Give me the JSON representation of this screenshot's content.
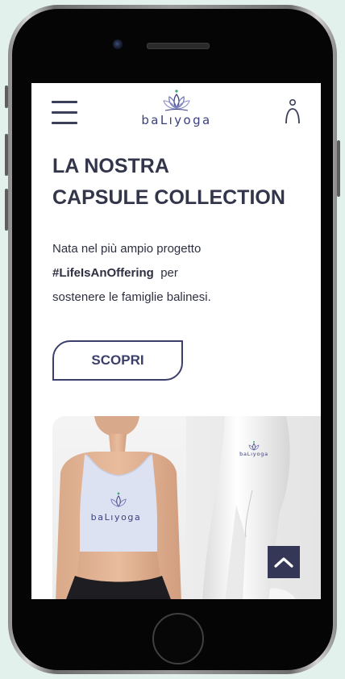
{
  "header": {
    "brand": "baLıyoga",
    "menu_icon": "hamburger-menu-icon",
    "account_icon": "user-icon",
    "brand_color": "#3a3f7d"
  },
  "hero": {
    "headline_line1": "LA NOSTRA",
    "headline_line2": "CAPSULE COLLECTION",
    "desc_line1": "Nata nel più ampio progetto",
    "desc_hashtag": "#LifeIsAnOffering",
    "desc_after_hashtag": "per",
    "desc_line3": "sostenere le famiglie balinesi.",
    "cta_label": "SCOPRI"
  },
  "gallery": {
    "top_logo": "baLıyoga",
    "leggings_logo": "baLıyoga"
  },
  "scroll_top": {
    "icon": "chevron-up-icon"
  },
  "colors": {
    "background": "#e3f1ec",
    "text_dark": "#33364a",
    "accent": "#3c3f6b",
    "scroll_button": "#343856"
  }
}
